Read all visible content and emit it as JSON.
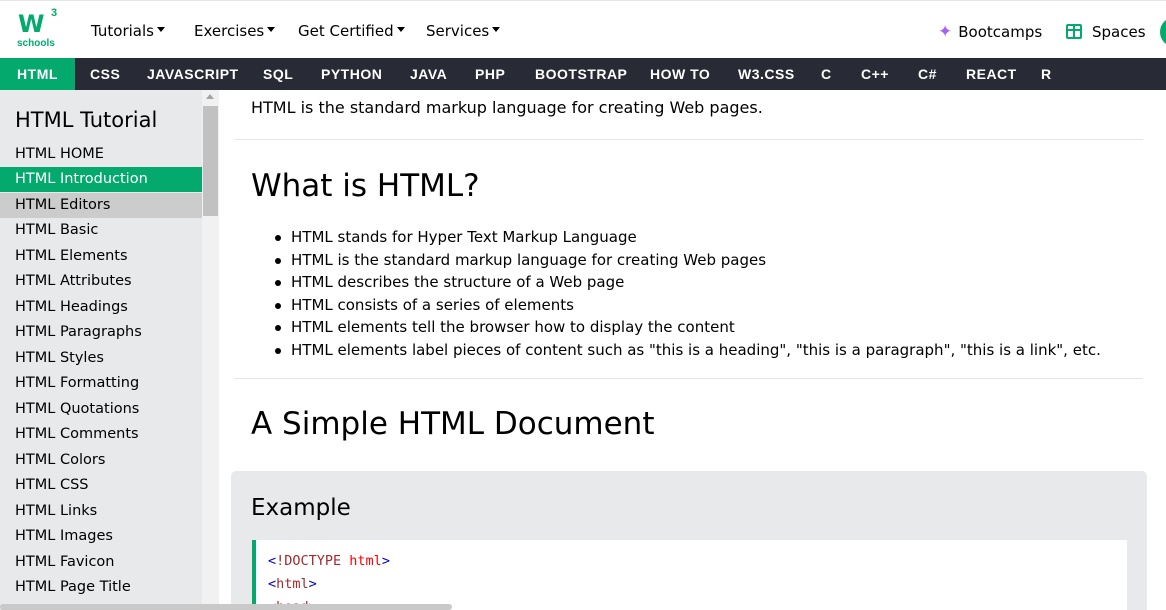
{
  "logo": {
    "mark": "W",
    "superscript": "3",
    "word": "schools"
  },
  "topnav": [
    {
      "label": "Tutorials"
    },
    {
      "label": "Exercises"
    },
    {
      "label": "Get Certified"
    },
    {
      "label": "Services"
    }
  ],
  "right_links": {
    "bootcamps": "Bootcamps",
    "spaces": "Spaces"
  },
  "subjects": [
    "HTML",
    "CSS",
    "JAVASCRIPT",
    "SQL",
    "PYTHON",
    "JAVA",
    "PHP",
    "BOOTSTRAP",
    "HOW TO",
    "W3.CSS",
    "C",
    "C++",
    "C#",
    "REACT",
    "R"
  ],
  "sidebar": {
    "title": "HTML Tutorial",
    "items": [
      "HTML HOME",
      "HTML Introduction",
      "HTML Editors",
      "HTML Basic",
      "HTML Elements",
      "HTML Attributes",
      "HTML Headings",
      "HTML Paragraphs",
      "HTML Styles",
      "HTML Formatting",
      "HTML Quotations",
      "HTML Comments",
      "HTML Colors",
      "HTML CSS",
      "HTML Links",
      "HTML Images",
      "HTML Favicon",
      "HTML Page Title"
    ],
    "active_index": 1,
    "hover_index": 2
  },
  "main": {
    "intro": "HTML is the standard markup language for creating Web pages.",
    "what_heading": "What is HTML?",
    "bullets": [
      "HTML stands for Hyper Text Markup Language",
      "HTML is the standard markup language for creating Web pages",
      "HTML describes the structure of a Web page",
      "HTML consists of a series of elements",
      "HTML elements tell the browser how to display the content",
      "HTML elements label pieces of content such as \"this is a heading\", \"this is a paragraph\", \"this is a link\", etc."
    ],
    "doc_heading": "A Simple HTML Document",
    "example_title": "Example",
    "code_lines": [
      {
        "open": "<",
        "tag": "!DOCTYPE",
        "attr": " html",
        "close": ">"
      },
      {
        "open": "<",
        "tag": "html",
        "attr": "",
        "close": ">"
      },
      {
        "open": "<",
        "tag": "head",
        "attr": "",
        "close": ">"
      }
    ]
  },
  "colors": {
    "accent": "#04aa6d",
    "subject_bar": "#282a35",
    "sidebar_bg": "#e7e9eb"
  },
  "icons": {
    "bootcamps": "sparkle-icon",
    "spaces": "gift-icon"
  }
}
